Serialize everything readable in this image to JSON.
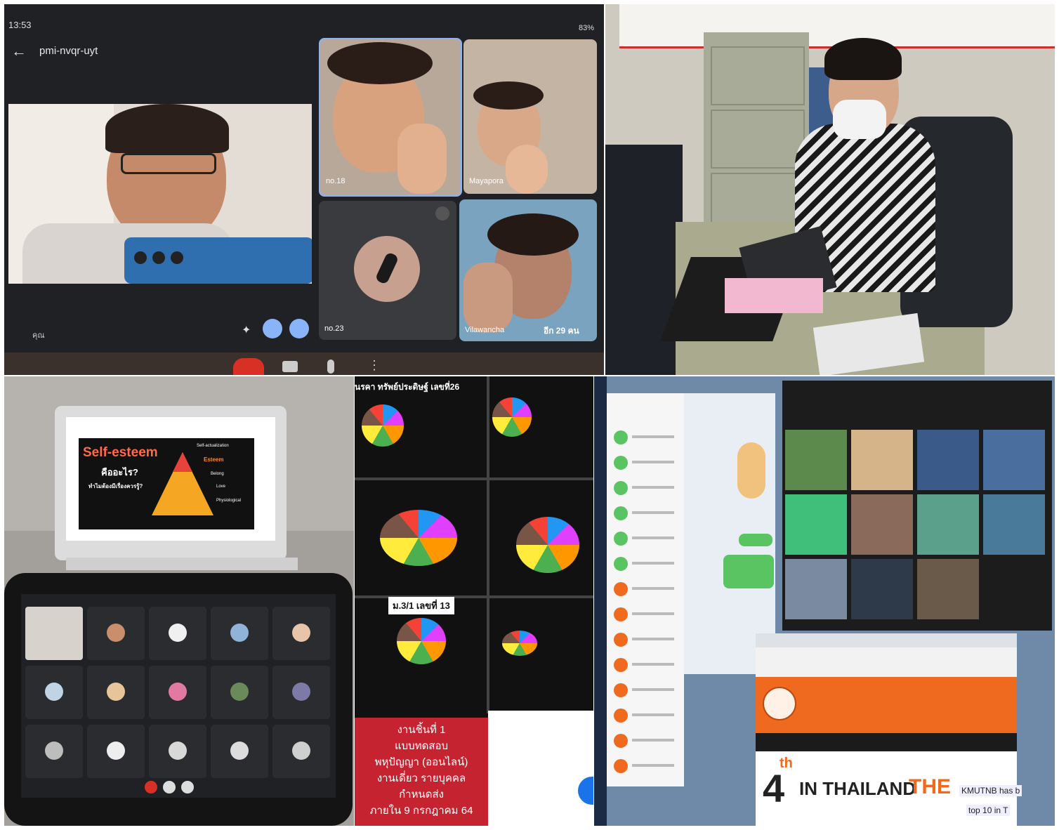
{
  "meet": {
    "status_time": "13:53",
    "battery": "83%",
    "meeting_code": "pmi-nvqr-uyt",
    "tiles": [
      {
        "label": "no.18"
      },
      {
        "label": "Mayapora"
      },
      {
        "label": "no.23"
      },
      {
        "label": "Vilawancha"
      }
    ],
    "self_label": "คุณ",
    "overflow_label": "อีก 29 คน"
  },
  "slide": {
    "title": "Self-esteem",
    "question": "คืออะไร?",
    "subtitle": "ทำไมต้องมีเรื่องควรรู้?",
    "levels": [
      "Self-actualization",
      "Esteem",
      "Belong",
      "Love",
      "Physiological"
    ]
  },
  "quiz": {
    "header": "นรคา ทรัพย์ประดิษฐ์ เลขที่26",
    "section_label": "ม.3/1 เลขที่ 13",
    "banner_lines": [
      "งานชิ้นที่ 1",
      "แบบทดสอบ",
      "พหุปัญญา (ออนไลน์)",
      "งานเดี่ยว รายบุคคล",
      "กำหนดส่ง",
      "ภายใน 9 กรกฎาคม 64"
    ]
  },
  "desktop": {
    "banner_superscript": "th",
    "banner_number": "4",
    "banner_text": "IN THAILAND",
    "banner_brand": "THE",
    "side_text_1": "KMUTNB has b",
    "side_text_2": "top 10 in T"
  },
  "colors": {
    "meet_bg": "#1f2124",
    "end_call": "#d93025",
    "banner_red": "#c62330",
    "web_orange": "#ef6a1e",
    "line_green": "#5ac463"
  }
}
